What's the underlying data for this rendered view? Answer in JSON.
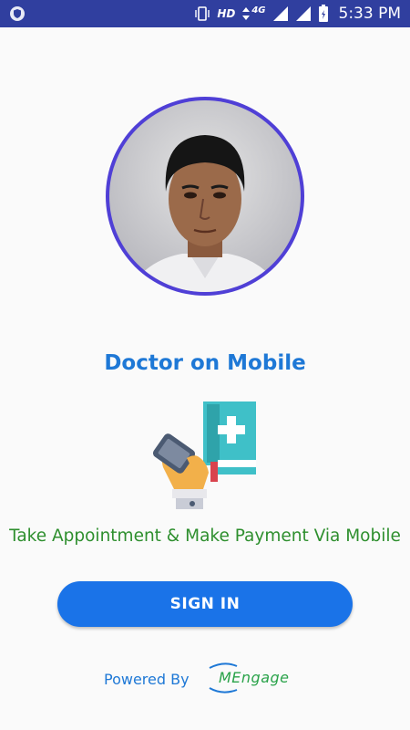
{
  "status_bar": {
    "network_label": "HD",
    "data_label": "4G",
    "time": "5:33 PM",
    "icons": [
      "app-shield-icon",
      "vibrate-icon",
      "signal-icon",
      "battery-icon"
    ]
  },
  "main": {
    "title": "Doctor on Mobile",
    "tagline": "Take Appointment & Make Payment Via Mobile",
    "signin_label": "SIGN IN"
  },
  "footer": {
    "powered_by": "Powered By",
    "logo_text": "MEngage"
  },
  "colors": {
    "status_bar": "#303f9f",
    "title": "#1e78d6",
    "tagline": "#2e8f2e",
    "button": "#1a73e8",
    "avatar_ring": "#4f3fd6"
  }
}
